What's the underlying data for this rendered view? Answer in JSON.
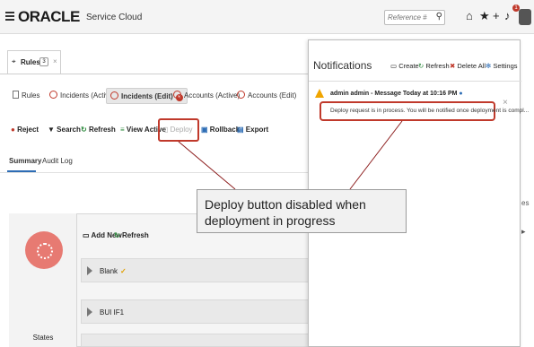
{
  "header": {
    "brand": "ORACLE",
    "product": "Service Cloud",
    "search_placeholder": "Reference #",
    "notification_count": "1"
  },
  "workspace_tab": {
    "label": "Rules",
    "count": "3",
    "close": "×"
  },
  "sub_tabs": [
    {
      "label": "Rules"
    },
    {
      "label": "Incidents (Active)"
    },
    {
      "label": "Incidents (Edit)"
    },
    {
      "label": "Accounts (Active)"
    },
    {
      "label": "Accounts (Edit)"
    }
  ],
  "toolbar": {
    "reject": "Reject",
    "search": "Search",
    "refresh": "Refresh",
    "view_active": "View Active",
    "deploy": "Deploy",
    "rollback": "Rollback",
    "export": "Export"
  },
  "summary_tabs": {
    "summary": "Summary",
    "audit_log": "Audit Log"
  },
  "states_label": "States",
  "list_actions": {
    "add_new": "Add New",
    "refresh": "Refresh"
  },
  "rows": [
    {
      "label": "Blank",
      "check": "✓"
    },
    {
      "label": "BUI IF1",
      "check": ""
    }
  ],
  "notifications": {
    "title": "Notifications",
    "create": "Create",
    "refresh": "Refresh",
    "delete_all": "Delete All",
    "settings": "Settings",
    "sender": "admin admin - Message Today at 10:16 PM",
    "message": "Deploy request is in process. You will be notified once deployment is compl...",
    "close": "×"
  },
  "callout": "Deploy button disabled when deployment in progress",
  "edge_text": {
    "top": "es",
    "bottom": "▸"
  },
  "colors": {
    "highlight": "#c0392b",
    "accent": "#2d6db5",
    "warning": "#f0a500"
  }
}
